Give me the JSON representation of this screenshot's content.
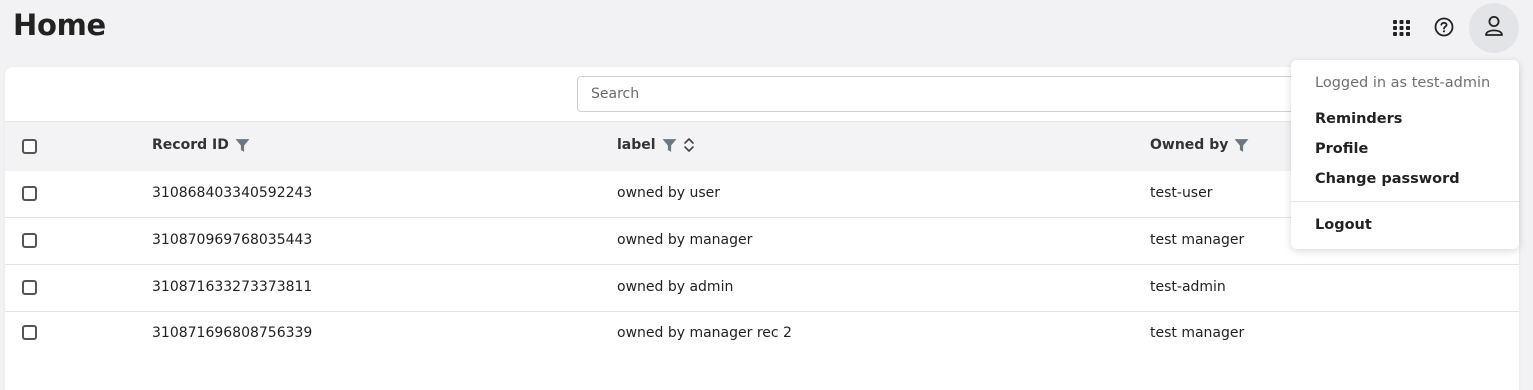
{
  "page": {
    "title": "Home"
  },
  "header": {
    "icons": [
      "apps-grid-icon",
      "help-circle-icon",
      "user-icon"
    ]
  },
  "search": {
    "placeholder": "Search",
    "value": ""
  },
  "table": {
    "columns": [
      {
        "label": "Record ID",
        "filter": true,
        "sort": false
      },
      {
        "label": "label",
        "filter": true,
        "sort": true
      },
      {
        "label": "Owned by",
        "filter": true,
        "sort": false
      }
    ],
    "rows": [
      {
        "record_id": "310868403340592243",
        "label": "owned by user",
        "owned_by": "test-user"
      },
      {
        "record_id": "310870969768035443",
        "label": "owned by manager",
        "owned_by": "test manager"
      },
      {
        "record_id": "310871633273373811",
        "label": "owned by admin",
        "owned_by": "test-admin"
      },
      {
        "record_id": "310871696808756339",
        "label": "owned by manager rec 2",
        "owned_by": "test manager"
      }
    ]
  },
  "user_menu": {
    "header": "Logged in as test-admin",
    "items": [
      "Reminders",
      "Profile",
      "Change password"
    ],
    "logout": "Logout"
  },
  "colors": {
    "background": "#f2f2f4",
    "filter_icon": "#6b7780",
    "avatar_bg": "#e2e4e8"
  }
}
